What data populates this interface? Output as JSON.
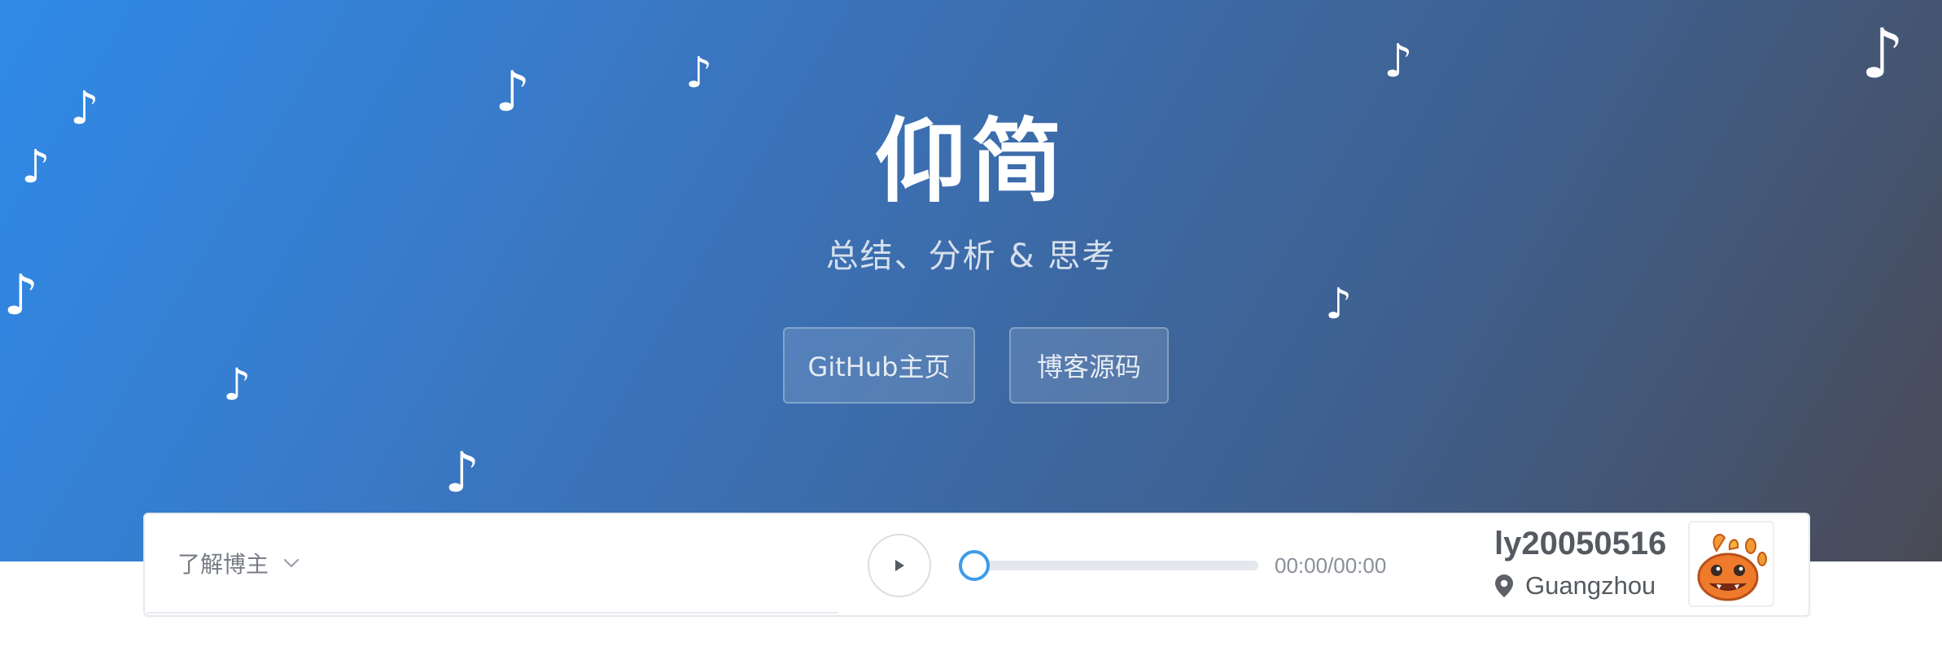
{
  "hero": {
    "title": "仰简",
    "subtitle": "总结、分析 & 思考",
    "buttons": {
      "github": "GitHub主页",
      "source": "博客源码"
    },
    "note_glyph": "♪"
  },
  "panel": {
    "about_label": "了解博主",
    "player": {
      "time": "00:00/00:00",
      "progress": 0
    },
    "profile": {
      "username": "ly20050516",
      "location": "Guangzhou"
    }
  },
  "colors": {
    "gradient_start": "#2f8ae8",
    "gradient_end": "#4a4a55",
    "accent": "#3d9be9",
    "avatar_orange": "#f07a2c"
  },
  "icons": [
    "music-note-icon",
    "chevron-down-icon",
    "play-icon",
    "location-pin-icon",
    "avatar-character"
  ]
}
